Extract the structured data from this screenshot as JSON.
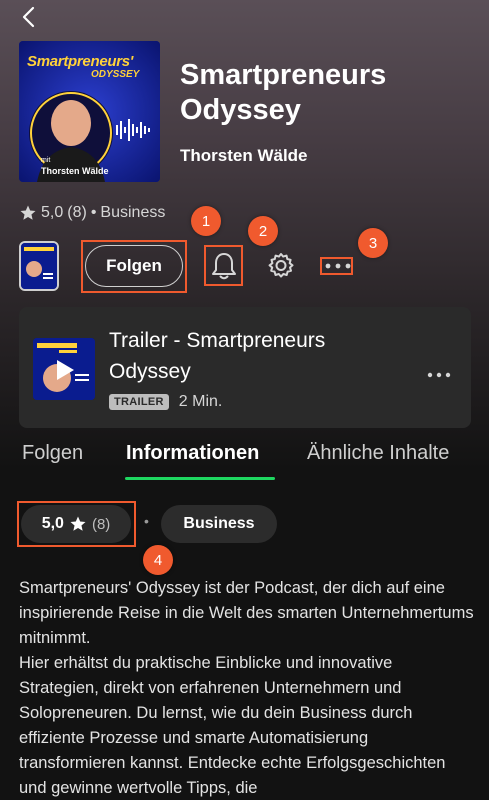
{
  "nav": {
    "back_icon": "chevron-left-icon"
  },
  "podcast": {
    "title": "Smartpreneurs Odyssey",
    "author": "Thorsten Wälde",
    "cover": {
      "brand_line1": "Smartpreneurs'",
      "brand_line2": "ODYSSEY",
      "by_line1": "mit",
      "by_line2": "Thorsten Wälde"
    }
  },
  "meta": {
    "rating": "5,0",
    "rating_count": "(8)",
    "separator": "•",
    "category": "Business"
  },
  "actions": {
    "follow_label": "Folgen"
  },
  "callouts": {
    "c1": "1",
    "c2": "2",
    "c3": "3",
    "c4": "4"
  },
  "trailer": {
    "title": "Trailer - Smartpreneurs Odyssey",
    "badge": "TRAILER",
    "duration": "2 Min."
  },
  "tabs": [
    {
      "label": "Folgen"
    },
    {
      "label": "Informationen"
    },
    {
      "label": "Ähnliche Inhalte"
    }
  ],
  "info": {
    "rating_pill": {
      "value": "5,0",
      "count": "(8)"
    },
    "separator": "•",
    "category_pill": "Business",
    "description": "Smartpreneurs' Odyssey ist der Podcast, der dich auf eine inspirierende Reise in die Welt des smarten Unternehmertums mitnimmt.\nHier erhältst du praktische Einblicke und innovative Strategien, direkt von erfahrenen Unternehmern und Solopreneuren. Du lernst, wie du dein Business durch effiziente Prozesse und smarte Automatisierung transformieren kannst. Entdecke echte Erfolgsgeschichten und gewinne wertvolle Tipps, die"
  },
  "colors": {
    "accent_green": "#1ed760",
    "callout_orange": "#f05a2e",
    "cover_blue": "#0a1c8f",
    "brand_yellow": "#ffd23a"
  }
}
